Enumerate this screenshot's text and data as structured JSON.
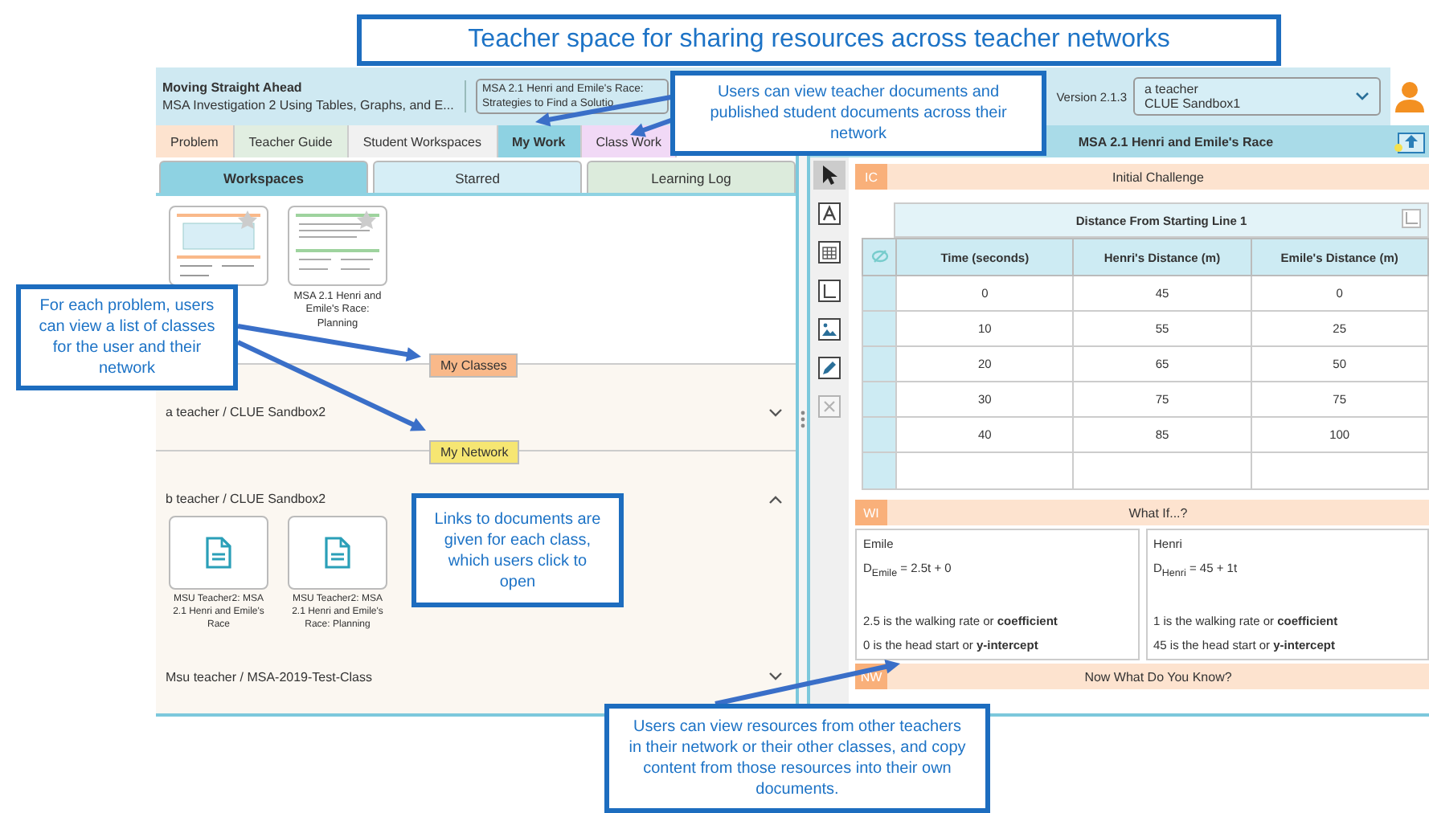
{
  "banner": "Teacher space for sharing resources across teacher networks",
  "header": {
    "unit_title": "Moving Straight Ahead",
    "investigation": "MSA Investigation 2 Using Tables, Graphs, and E...",
    "problem_line_1": "MSA 2.1 Henri and Emile's Race:",
    "problem_line_2": "Strategies to Find a Solutio",
    "version": "Version 2.1.3",
    "user_name": "a teacher",
    "user_class": "CLUE Sandbox1"
  },
  "tabs": [
    {
      "label": "Problem",
      "selected": false,
      "color": "#fde3cf"
    },
    {
      "label": "Teacher Guide",
      "selected": false,
      "color": "#e1eee1"
    },
    {
      "label": "Student Workspaces",
      "selected": false,
      "color": "#f1f1f1"
    },
    {
      "label": "My Work",
      "selected": true,
      "color": "#8ed2e2"
    },
    {
      "label": "Class Work",
      "selected": false,
      "color": "#f1d9f6"
    }
  ],
  "subtabs": [
    {
      "label": "Workspaces",
      "selected": true,
      "color": "#8ed2e2"
    },
    {
      "label": "Starred",
      "selected": false,
      "color": "#d6eef6"
    },
    {
      "label": "Learning Log",
      "selected": false,
      "color": "#dcebdc"
    }
  ],
  "workspaces": [
    {
      "kind": "table"
    },
    {
      "kind": "text",
      "label": "MSA 2.1 Henri and Emile's Race: Planning"
    }
  ],
  "sections": [
    {
      "label": "My Classes",
      "color": "#f9b98a",
      "classes": [
        {
          "name": "a teacher / CLUE Sandbox2",
          "expanded": false
        }
      ]
    },
    {
      "label": "My Network",
      "color": "#f6e672",
      "classes": [
        {
          "name": "b teacher / CLUE Sandbox2",
          "expanded": true,
          "documents": [
            "MSU Teacher2: MSA 2.1 Henri and Emile's Race",
            "MSU Teacher2: MSA 2.1 Henri and Emile's Race: Planning"
          ]
        },
        {
          "name": "Msu teacher / MSA-2019-Test-Class",
          "expanded": false
        }
      ]
    }
  ],
  "document": {
    "title": "MSA 2.1 Henri and Emile's Race",
    "tools": [
      {
        "kind": "select",
        "selected": true,
        "disabled": false
      },
      {
        "kind": "text",
        "selected": false,
        "disabled": false
      },
      {
        "kind": "table",
        "selected": false,
        "disabled": false
      },
      {
        "kind": "graph",
        "selected": false,
        "disabled": false
      },
      {
        "kind": "image",
        "selected": false,
        "disabled": false
      },
      {
        "kind": "draw",
        "selected": false,
        "disabled": false
      },
      {
        "kind": "delete",
        "selected": false,
        "disabled": true
      }
    ],
    "initial_challenge": {
      "tag": "IC",
      "title": "Initial Challenge"
    },
    "table": {
      "title": "Distance From Starting Line 1",
      "columns": [
        "Time (seconds)",
        "Henri's Distance (m)",
        "Emile's Distance (m)"
      ],
      "rows": [
        [
          "0",
          "45",
          "0"
        ],
        [
          "10",
          "55",
          "25"
        ],
        [
          "20",
          "65",
          "50"
        ],
        [
          "30",
          "75",
          "75"
        ],
        [
          "40",
          "85",
          "100"
        ]
      ]
    },
    "what_if": {
      "tag": "WI",
      "title": "What If...?",
      "columns": [
        {
          "name": "Emile",
          "equation": "D$_{Emile}$ = 2.5t  + 0",
          "lines": [
            "2.5 is the walking rate or **coefficient**",
            "0 is the head start or **y-intercept**"
          ]
        },
        {
          "name": "Henri",
          "equation": "D$_{Henri}$ = 45 + 1t",
          "lines": [
            "1 is the walking rate or **coefficient**",
            "45 is the head start or **y-intercept**"
          ]
        }
      ]
    },
    "now_what": {
      "tag": "NW",
      "title": "Now What Do You Know?"
    }
  },
  "callouts": [
    "Users can view teacher documents and published student documents across their network",
    "For each problem, users can view a list of classes for the user and their network",
    "Links to documents are given for each class, which users click to open",
    "Users can view resources from other teachers in their network or their other classes, and copy content from those resources into their own documents."
  ]
}
